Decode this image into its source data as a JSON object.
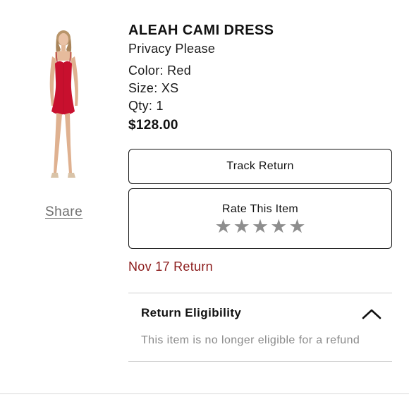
{
  "product": {
    "title": "ALEAH CAMI DRESS",
    "brand": "Privacy Please",
    "color": "Color: Red",
    "size": "Size: XS",
    "qty": "Qty: 1",
    "price": "$128.00",
    "image_icon": "red-cami-dress-photo"
  },
  "share": {
    "label": "Share"
  },
  "actions": {
    "track_return_label": "Track Return",
    "rate_label": "Rate This Item",
    "rating_max": 5,
    "rating_value": 0
  },
  "return_status": "Nov 17 Return",
  "eligibility": {
    "title": "Return Eligibility",
    "message": "This item is no longer eligible for a refund",
    "expanded": true
  },
  "colors": {
    "status_red": "#8b1a1a",
    "star_gray": "#8e8e8e",
    "dress_red": "#c8102e"
  }
}
